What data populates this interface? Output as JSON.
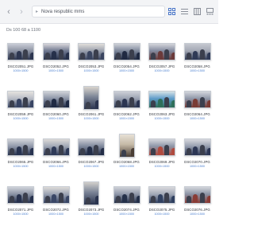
{
  "toolbar": {
    "back_icon": "chevron-left-icon",
    "forward_icon": "chevron-right-icon",
    "path_text": "Nova respublic mms"
  },
  "subbar": {
    "summary": "Ds 100 68 a 1100"
  },
  "colors": {
    "accent": "#4a76c9",
    "dim_text": "#4a7fcf"
  },
  "files": [
    {
      "name": "DSCO2051.JPG",
      "dims": "1000×1500",
      "orient": "land",
      "scene": [
        "#8c93a3",
        "#2d3650",
        "#c9ccd6"
      ]
    },
    {
      "name": "DSCO2052.JPG",
      "dims": "1000×1500",
      "orient": "land",
      "scene": [
        "#6f7890",
        "#26304a",
        "#d8d6da"
      ]
    },
    {
      "name": "DSCO2053.JPG",
      "dims": "1000×1500",
      "orient": "land",
      "scene": [
        "#9aa0ad",
        "#3a4560",
        "#e1dedb"
      ]
    },
    {
      "name": "DSCO2054.JPG",
      "dims": "1000×1500",
      "orient": "land",
      "scene": [
        "#7e889b",
        "#202a42",
        "#cfd1d8"
      ]
    },
    {
      "name": "DSCO2057.JPG",
      "dims": "1000×1500",
      "orient": "land",
      "scene": [
        "#838a9e",
        "#6b3a3a",
        "#d3d4da"
      ]
    },
    {
      "name": "DSCO2058.JPG",
      "dims": "1000×1500",
      "orient": "land",
      "scene": [
        "#a3a8b4",
        "#2f3a56",
        "#c6c8cf"
      ]
    },
    {
      "name": "DSCO2059.JPG",
      "dims": "1000×1500",
      "orient": "land",
      "scene": [
        "#b8bcc6",
        "#384463",
        "#e6e3df"
      ]
    },
    {
      "name": "DSCO2060.JPG",
      "dims": "1000×1500",
      "orient": "land",
      "scene": [
        "#8a93a6",
        "#1f2a44",
        "#d0d2d8"
      ]
    },
    {
      "name": "DSCO2061.JPG",
      "dims": "1000×1500",
      "orient": "port",
      "scene": [
        "#7d8697",
        "#2a3450",
        "#d9d4cd"
      ]
    },
    {
      "name": "DSCO2062.JPG",
      "dims": "1000×1500",
      "orient": "land",
      "scene": [
        "#9aa2b2",
        "#2b3552",
        "#cdd0d7"
      ]
    },
    {
      "name": "DSCO2063.JPG",
      "dims": "1000×1500",
      "orient": "land",
      "scene": [
        "#5e9bc9",
        "#2f6f5a",
        "#d6e2e6"
      ]
    },
    {
      "name": "DSCO2064.JPG",
      "dims": "1000×1500",
      "orient": "land",
      "scene": [
        "#8e96a8",
        "#7a3b34",
        "#d4d6dc"
      ]
    },
    {
      "name": "DSCO2065.JPG",
      "dims": "1000×1500",
      "orient": "land",
      "scene": [
        "#9098aa",
        "#283350",
        "#d2d4da"
      ]
    },
    {
      "name": "DSCO2066.JPG",
      "dims": "1000×1500",
      "orient": "land",
      "scene": [
        "#a0a7b5",
        "#2e3a58",
        "#dcdad8"
      ]
    },
    {
      "name": "DSCO2067.JPG",
      "dims": "1000×1500",
      "orient": "land",
      "scene": [
        "#7f889c",
        "#232d47",
        "#c8cad2"
      ]
    },
    {
      "name": "DSCO2068.JPG",
      "dims": "1000×1500",
      "orient": "port",
      "scene": [
        "#c5b9a6",
        "#4a3e35",
        "#e7e1d6"
      ]
    },
    {
      "name": "DSCO2069.JPG",
      "dims": "1000×1500",
      "orient": "land",
      "scene": [
        "#8d95a7",
        "#b04a3e",
        "#d5d7dd"
      ]
    },
    {
      "name": "DSCO2070.JPG",
      "dims": "1000×1500",
      "orient": "land",
      "scene": [
        "#959dae",
        "#2c3654",
        "#d7d8de"
      ]
    },
    {
      "name": "DSCO2071.JPG",
      "dims": "1000×1500",
      "orient": "land",
      "scene": [
        "#8a92a4",
        "#27314d",
        "#d0d3da"
      ]
    },
    {
      "name": "DSCO2072.JPG",
      "dims": "1000×1500",
      "orient": "land",
      "scene": [
        "#9ba3b3",
        "#3a4766",
        "#dddbd8"
      ]
    },
    {
      "name": "DSCO2073.JPG",
      "dims": "1000×1500",
      "orient": "port",
      "scene": [
        "#7a8396",
        "#2a344f",
        "#d1cfcb"
      ]
    },
    {
      "name": "DSCO2074.JPG",
      "dims": "1000×1500",
      "orient": "land",
      "scene": [
        "#8f97a9",
        "#243049",
        "#cfd1d8"
      ]
    },
    {
      "name": "DSCO2075.JPG",
      "dims": "1000×1500",
      "orient": "land",
      "scene": [
        "#a2a9b7",
        "#304060",
        "#d9d9dc"
      ]
    },
    {
      "name": "DSCO2076.JPG",
      "dims": "1000×1500",
      "orient": "land",
      "scene": [
        "#8b93a5",
        "#8a3c36",
        "#d3d5db"
      ]
    }
  ]
}
